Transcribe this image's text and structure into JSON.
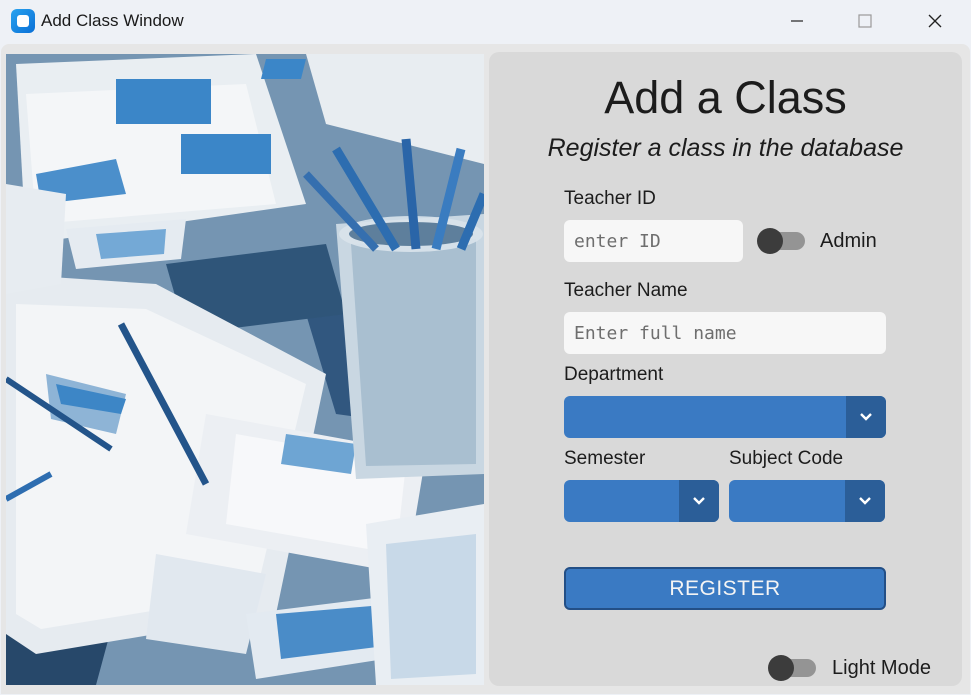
{
  "window": {
    "title": "Add Class Window",
    "controls": [
      "minimize-icon",
      "maximize-icon",
      "close-icon"
    ]
  },
  "form": {
    "heading": "Add a Class",
    "subheading": "Register a class in the database",
    "teacher_id": {
      "label": "Teacher ID",
      "placeholder": "enter ID",
      "value": ""
    },
    "admin_toggle": {
      "label": "Admin",
      "on": false
    },
    "teacher_name": {
      "label": "Teacher Name",
      "placeholder": "Enter full name",
      "value": ""
    },
    "department": {
      "label": "Department",
      "value": ""
    },
    "semester": {
      "label": "Semester",
      "value": ""
    },
    "subject_code": {
      "label": "Subject Code",
      "value": ""
    },
    "register_label": "REGISTER",
    "light_mode_toggle": {
      "label": "Light Mode",
      "on": false
    }
  },
  "colors": {
    "accent": "#3a7ac3",
    "accent_dark": "#2b5e98",
    "panel": "#d9d9d9",
    "field": "#f7f7f7"
  }
}
